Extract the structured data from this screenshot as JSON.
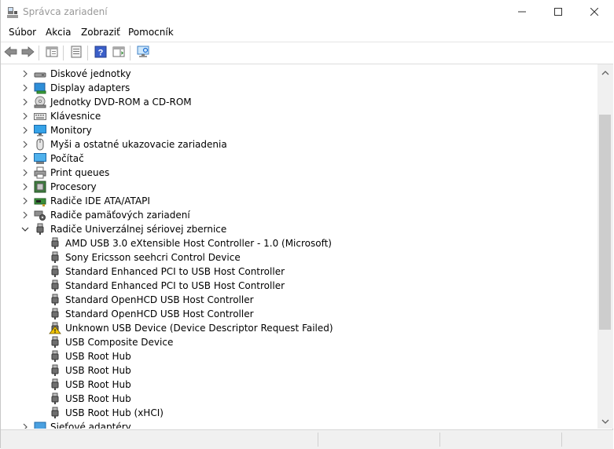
{
  "window": {
    "title": "Správca zariadení",
    "icons": {
      "app": "device-manager-icon",
      "minimize": "minimize-icon",
      "maximize": "maximize-icon",
      "close": "close-icon"
    }
  },
  "menu": {
    "items": [
      {
        "label": "Súbor"
      },
      {
        "label": "Akcia"
      },
      {
        "label": "Zobraziť"
      },
      {
        "label": "Pomocník"
      }
    ]
  },
  "toolbar": {
    "buttons": [
      {
        "icon": "back-arrow-icon"
      },
      {
        "icon": "forward-arrow-icon"
      },
      {
        "icon": "show-hide-console-tree-icon"
      },
      {
        "icon": "properties-icon"
      },
      {
        "icon": "help-icon"
      },
      {
        "icon": "action-pane-icon"
      },
      {
        "icon": "scan-hardware-icon"
      }
    ]
  },
  "tree": {
    "categories": [
      {
        "label": "Diskové jednotky",
        "icon": "disk-drive-icon",
        "expanded": false
      },
      {
        "label": "Display adapters",
        "icon": "display-adapter-icon",
        "expanded": false
      },
      {
        "label": "Jednotky DVD-ROM a CD-ROM",
        "icon": "dvd-drive-icon",
        "expanded": false
      },
      {
        "label": "Klávesnice",
        "icon": "keyboard-icon",
        "expanded": false
      },
      {
        "label": "Monitory",
        "icon": "monitor-icon",
        "expanded": false
      },
      {
        "label": "Myši a ostatné ukazovacie zariadenia",
        "icon": "mouse-icon",
        "expanded": false
      },
      {
        "label": "Počítač",
        "icon": "computer-icon",
        "expanded": false
      },
      {
        "label": "Print queues",
        "icon": "printer-icon",
        "expanded": false
      },
      {
        "label": "Procesory",
        "icon": "processor-icon",
        "expanded": false
      },
      {
        "label": "Radiče IDE ATA/ATAPI",
        "icon": "ide-controller-icon",
        "expanded": false
      },
      {
        "label": "Radiče pamäťových zariadení",
        "icon": "storage-controller-icon",
        "expanded": false
      },
      {
        "label": "Radiče Univerzálnej sériovej zbernice",
        "icon": "usb-controller-icon",
        "expanded": true
      }
    ],
    "usb_children": [
      {
        "label": "AMD USB 3.0 eXtensible Host Controller - 1.0 (Microsoft)",
        "icon": "usb-plug-icon",
        "warning": false
      },
      {
        "label": "Sony Ericsson seehcri Control Device",
        "icon": "usb-plug-icon",
        "warning": false
      },
      {
        "label": "Standard Enhanced PCI to USB Host Controller",
        "icon": "usb-plug-icon",
        "warning": false
      },
      {
        "label": "Standard Enhanced PCI to USB Host Controller",
        "icon": "usb-plug-icon",
        "warning": false
      },
      {
        "label": "Standard OpenHCD USB Host Controller",
        "icon": "usb-plug-icon",
        "warning": false
      },
      {
        "label": "Standard OpenHCD USB Host Controller",
        "icon": "usb-plug-icon",
        "warning": false
      },
      {
        "label": "Unknown USB Device (Device Descriptor Request Failed)",
        "icon": "warning-icon",
        "warning": true
      },
      {
        "label": "USB Composite Device",
        "icon": "usb-plug-icon",
        "warning": false
      },
      {
        "label": "USB Root Hub",
        "icon": "usb-plug-icon",
        "warning": false
      },
      {
        "label": "USB Root Hub",
        "icon": "usb-plug-icon",
        "warning": false
      },
      {
        "label": "USB Root Hub",
        "icon": "usb-plug-icon",
        "warning": false
      },
      {
        "label": "USB Root Hub",
        "icon": "usb-plug-icon",
        "warning": false
      },
      {
        "label": "USB Root Hub (xHCI)",
        "icon": "usb-plug-icon",
        "warning": false
      }
    ],
    "after": [
      {
        "label": "Sieťové adaptéry",
        "icon": "network-adapter-icon",
        "expanded": false
      }
    ]
  },
  "colors": {
    "accent": "#1e6fd6",
    "warning": "#f2c400",
    "scrollbar": "#cdcdcd"
  }
}
